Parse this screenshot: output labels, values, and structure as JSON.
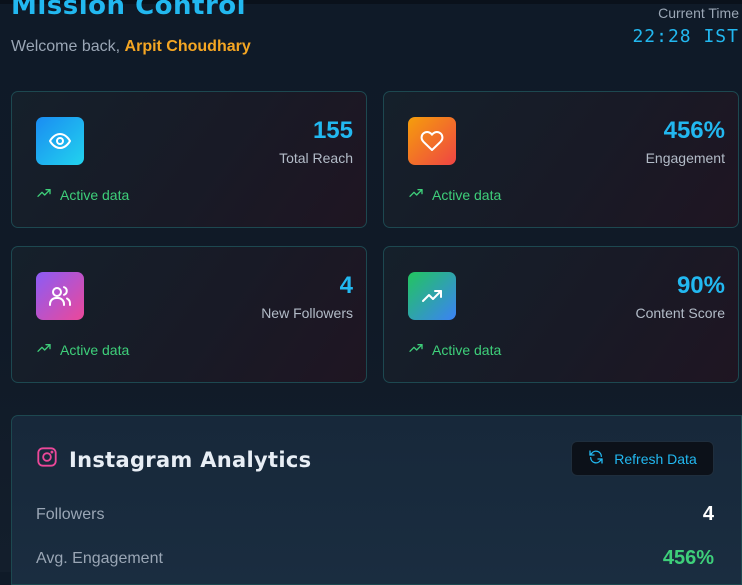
{
  "header": {
    "title": "Mission Control",
    "welcome_prefix": "Welcome back,",
    "user_name": "Arpit Choudhary",
    "time_label": "Current Time",
    "time_value": "22:28 IST"
  },
  "stats": [
    {
      "value": "155",
      "label": "Total Reach",
      "status": "Active data",
      "icon": "eye-icon"
    },
    {
      "value": "456%",
      "label": "Engagement",
      "status": "Active data",
      "icon": "heart-icon"
    },
    {
      "value": "4",
      "label": "New Followers",
      "status": "Active data",
      "icon": "users-icon"
    },
    {
      "value": "90%",
      "label": "Content Score",
      "status": "Active data",
      "icon": "trending-up-icon"
    }
  ],
  "instagram": {
    "title": "Instagram Analytics",
    "refresh_label": "Refresh Data",
    "metrics": [
      {
        "label": "Followers",
        "value": "4",
        "color": "#ffffff"
      },
      {
        "label": "Avg. Engagement",
        "value": "456%",
        "color": "#3ecf7a"
      }
    ]
  },
  "colors": {
    "accent": "#22b8f0",
    "user_highlight": "#f5a623",
    "positive": "#3ecf7a"
  }
}
